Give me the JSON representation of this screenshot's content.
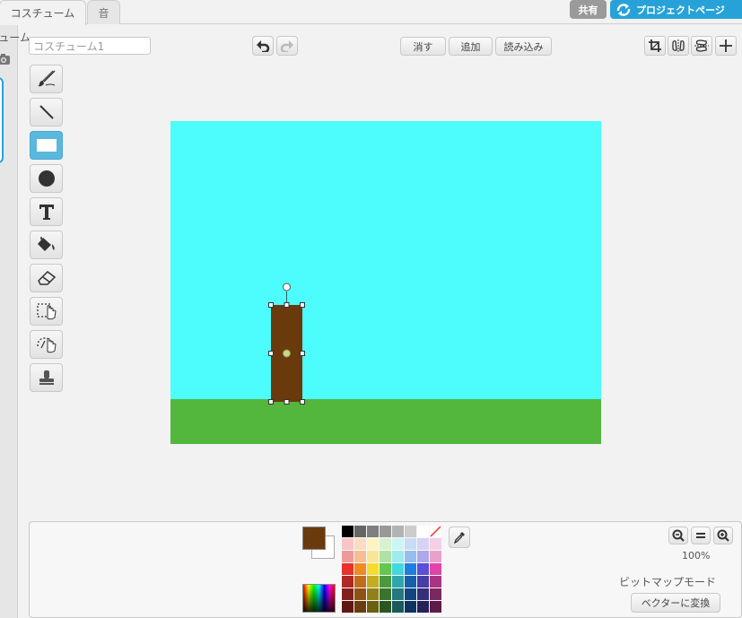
{
  "tabs": [
    {
      "label": "コスチューム",
      "active": true
    },
    {
      "label": "音",
      "active": false
    }
  ],
  "header": {
    "share_label": "共有",
    "project_page_label": "プロジェクトページ"
  },
  "sidebar": {
    "costume_label": "コスチューム:",
    "camera_icon": "camera-icon"
  },
  "editor": {
    "costume_name": "コスチューム1",
    "clear_label": "消す",
    "add_label": "追加",
    "import_label": "読み込み"
  },
  "tools": [
    {
      "name": "brush-icon",
      "selected": false
    },
    {
      "name": "line-icon",
      "selected": false
    },
    {
      "name": "rectangle-icon",
      "selected": true
    },
    {
      "name": "ellipse-icon",
      "selected": false
    },
    {
      "name": "text-icon",
      "selected": false
    },
    {
      "name": "fill-bucket-icon",
      "selected": false
    },
    {
      "name": "eraser-icon",
      "selected": false
    },
    {
      "name": "select-icon",
      "selected": false
    },
    {
      "name": "magic-select-icon",
      "selected": false
    },
    {
      "name": "stamp-icon",
      "selected": false
    }
  ],
  "canvas": {
    "sky_color": "#4dfcfc",
    "ground_color": "#53b63d",
    "shape_color": "#6a3a0c"
  },
  "colors": {
    "foreground": "#6a3a0c",
    "background": "#ffffff",
    "accent": "#27a2d8",
    "palette": [
      "#000000",
      "#666666",
      "#7f7f7f",
      "#999999",
      "#b3b3b3",
      "#cccccc",
      "#ffffff",
      "none",
      "#f7c6c6",
      "#fbdcc2",
      "#fdf3c2",
      "#d8f1d3",
      "#cdf5f5",
      "#c9dcf7",
      "#d6d3f5",
      "#f5cfe6",
      "#ef9a9a",
      "#f7be93",
      "#f9e695",
      "#b1e0a7",
      "#9eebeb",
      "#96bdf0",
      "#ada8ec",
      "#e9a1cb",
      "#e8322b",
      "#f28a22",
      "#f6dc2b",
      "#64c652",
      "#42d8df",
      "#1d7fe3",
      "#5a4fd9",
      "#e044a9",
      "#b02723",
      "#c06d1b",
      "#c2ac22",
      "#4a9a3d",
      "#2fa6ab",
      "#165fac",
      "#463da6",
      "#a93483",
      "#84201c",
      "#8f5115",
      "#908017",
      "#39742d",
      "#23797d",
      "#11477f",
      "#352f7a",
      "#7c2762",
      "#601713",
      "#6b3c0f",
      "#6b5f11",
      "#2b5622",
      "#195a5d",
      "#0c3460",
      "#27215a",
      "#5c1c47"
    ]
  },
  "zoom": {
    "level": "100%"
  },
  "mode": {
    "label": "ビットマップモード",
    "convert_label": "ベクターに変換"
  }
}
